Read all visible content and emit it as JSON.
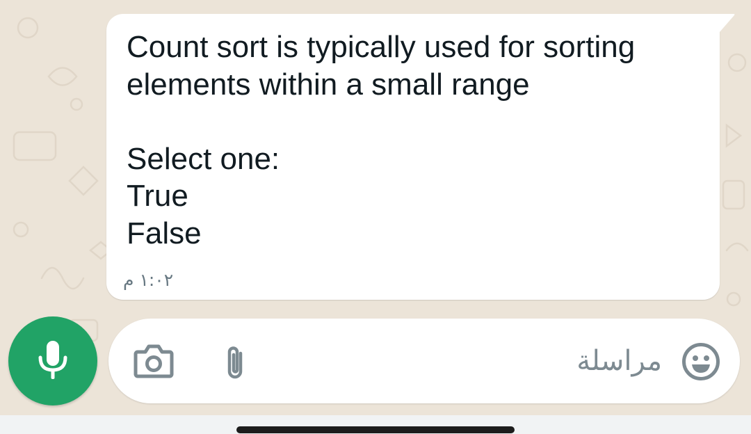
{
  "chat": {
    "message": {
      "lines": {
        "l1": "Count sort is typically used for sorting",
        "l2": "elements within a small range",
        "l3": "Select one:",
        "l4": "True",
        "l5": "False"
      },
      "time": "١:٠٢ م"
    }
  },
  "composer": {
    "placeholder": "مراسلة",
    "icons": {
      "mic": "mic-icon",
      "camera": "camera-icon",
      "attach": "paperclip-icon",
      "emoji": "emoji-icon"
    }
  },
  "colors": {
    "wallpaper": "#ece4d8",
    "bubble": "#ffffff",
    "mic_button": "#21a366",
    "icon_gray": "#7d8a91",
    "text": "#111b21",
    "timestamp": "#667781"
  }
}
